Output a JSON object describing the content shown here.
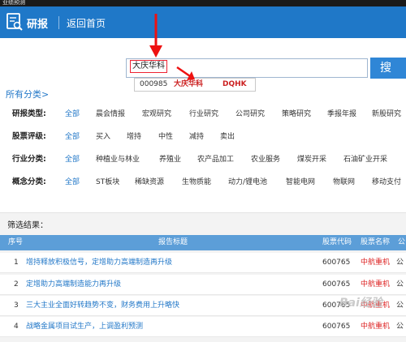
{
  "window": {
    "title": "业绩预测"
  },
  "header": {
    "title": "研报",
    "home_link": "返回首页"
  },
  "search": {
    "value": "大庆华科",
    "button_label": "搜 索"
  },
  "suggestion": {
    "code": "000985",
    "name": "大庆华科",
    "abbr": "DQHK"
  },
  "all_categories": "所有分类>",
  "filters": [
    {
      "label": "研报类型:",
      "items": [
        "全部",
        "晨会情报",
        "宏观研究",
        "行业研究",
        "公司研究",
        "策略研究",
        "季报年报",
        "新股研究"
      ]
    },
    {
      "label": "股票评级:",
      "items": [
        "全部",
        "买入",
        "增持",
        "中性",
        "减持",
        "卖出"
      ]
    },
    {
      "label": "行业分类:",
      "items": [
        "全部",
        "种植业与林业",
        "养殖业",
        "农产品加工",
        "农业服务",
        "煤炭开采",
        "石油矿业开采"
      ]
    },
    {
      "label": "概念分类:",
      "items": [
        "全部",
        "ST板块",
        "稀缺资源",
        "生物质能",
        "动力/锂电池",
        "智能电网",
        "物联网",
        "移动支付"
      ]
    }
  ],
  "results": {
    "title": "筛选结果：",
    "columns": [
      "序号",
      "报告标题",
      "股票代码",
      "股票名称",
      "公"
    ],
    "rows": [
      {
        "idx": "1",
        "title": "增持释放积极信号，定增助力高端制造再升级",
        "code": "600765",
        "name": "中航重机",
        "more": "公"
      },
      {
        "idx": "2",
        "title": "定增助力高端制造能力再升级",
        "code": "600765",
        "name": "中航重机",
        "more": "公"
      },
      {
        "idx": "3",
        "title": "三大主业全面好转趋势不变，财务费用上升略快",
        "code": "600765",
        "name": "中航重机",
        "more": "公"
      },
      {
        "idx": "4",
        "title": "战略金属项目试生产，上调盈利预测",
        "code": "600765",
        "name": "中航重机",
        "more": "公"
      }
    ]
  },
  "watermark": "Bai经验",
  "colors": {
    "header": "#1f78c8",
    "link": "#2378c8",
    "stock_name": "#dd2222",
    "table_header": "#5c9ed8"
  },
  "icons": [
    "report-logo-icon",
    "annotation-arrow-icon"
  ]
}
